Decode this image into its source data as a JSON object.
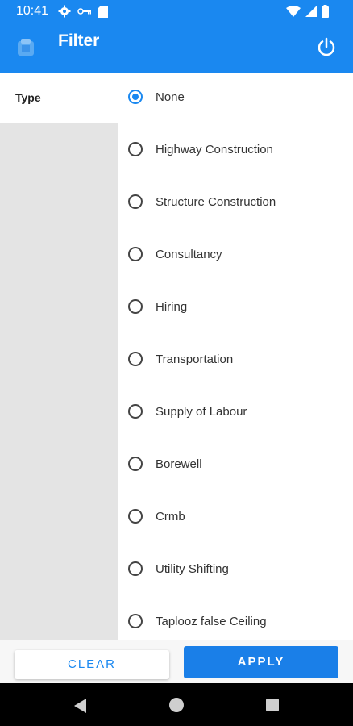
{
  "status_bar": {
    "time": "10:41",
    "icons_left": [
      "settings-gear-icon",
      "vpn-key-icon",
      "sd-card-icon"
    ],
    "icons_right": [
      "wifi-icon",
      "cellular-signal-icon",
      "battery-icon"
    ]
  },
  "app_bar": {
    "title": "Filter",
    "logo_icon": "app-logo-icon",
    "power_icon": "power-icon"
  },
  "sidebar": {
    "tabs": [
      {
        "label": "Type",
        "selected": true
      }
    ]
  },
  "options": [
    {
      "label": "None",
      "selected": true
    },
    {
      "label": "Highway Construction",
      "selected": false
    },
    {
      "label": "Structure Construction",
      "selected": false
    },
    {
      "label": "Consultancy",
      "selected": false
    },
    {
      "label": "Hiring",
      "selected": false
    },
    {
      "label": "Transportation",
      "selected": false
    },
    {
      "label": "Supply of Labour",
      "selected": false
    },
    {
      "label": "Borewell",
      "selected": false
    },
    {
      "label": "Crmb",
      "selected": false
    },
    {
      "label": "Utility Shifting",
      "selected": false
    },
    {
      "label": "Taplooz false Ceiling",
      "selected": false
    }
  ],
  "footer": {
    "clear_label": "CLEAR",
    "apply_label": "APPLY"
  },
  "nav_bar": {
    "icons": [
      "back-icon",
      "home-icon",
      "recents-icon"
    ]
  },
  "colors": {
    "primary": "#1a88f0",
    "sidebar_bg": "#e4e4e4",
    "text": "#333333"
  }
}
